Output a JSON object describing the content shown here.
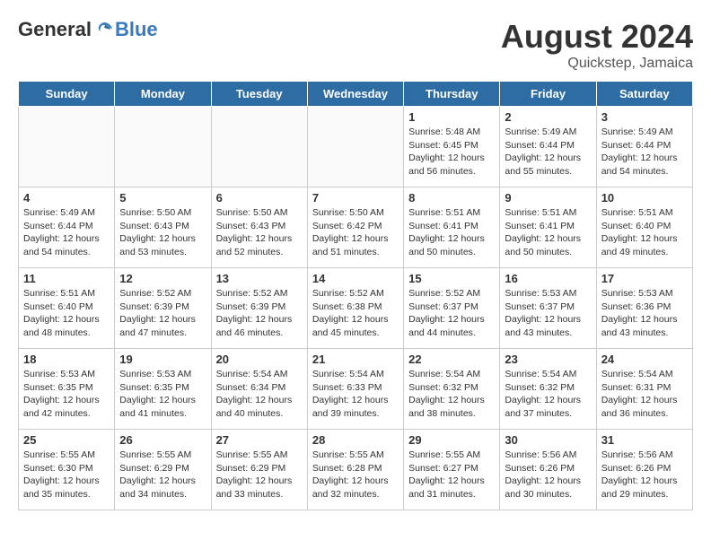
{
  "header": {
    "logo_general": "General",
    "logo_blue": "Blue",
    "month_year": "August 2024",
    "location": "Quickstep, Jamaica"
  },
  "days_of_week": [
    "Sunday",
    "Monday",
    "Tuesday",
    "Wednesday",
    "Thursday",
    "Friday",
    "Saturday"
  ],
  "weeks": [
    [
      {
        "day": "",
        "info": ""
      },
      {
        "day": "",
        "info": ""
      },
      {
        "day": "",
        "info": ""
      },
      {
        "day": "",
        "info": ""
      },
      {
        "day": "1",
        "info": "Sunrise: 5:48 AM\nSunset: 6:45 PM\nDaylight: 12 hours\nand 56 minutes."
      },
      {
        "day": "2",
        "info": "Sunrise: 5:49 AM\nSunset: 6:44 PM\nDaylight: 12 hours\nand 55 minutes."
      },
      {
        "day": "3",
        "info": "Sunrise: 5:49 AM\nSunset: 6:44 PM\nDaylight: 12 hours\nand 54 minutes."
      }
    ],
    [
      {
        "day": "4",
        "info": "Sunrise: 5:49 AM\nSunset: 6:44 PM\nDaylight: 12 hours\nand 54 minutes."
      },
      {
        "day": "5",
        "info": "Sunrise: 5:50 AM\nSunset: 6:43 PM\nDaylight: 12 hours\nand 53 minutes."
      },
      {
        "day": "6",
        "info": "Sunrise: 5:50 AM\nSunset: 6:43 PM\nDaylight: 12 hours\nand 52 minutes."
      },
      {
        "day": "7",
        "info": "Sunrise: 5:50 AM\nSunset: 6:42 PM\nDaylight: 12 hours\nand 51 minutes."
      },
      {
        "day": "8",
        "info": "Sunrise: 5:51 AM\nSunset: 6:41 PM\nDaylight: 12 hours\nand 50 minutes."
      },
      {
        "day": "9",
        "info": "Sunrise: 5:51 AM\nSunset: 6:41 PM\nDaylight: 12 hours\nand 50 minutes."
      },
      {
        "day": "10",
        "info": "Sunrise: 5:51 AM\nSunset: 6:40 PM\nDaylight: 12 hours\nand 49 minutes."
      }
    ],
    [
      {
        "day": "11",
        "info": "Sunrise: 5:51 AM\nSunset: 6:40 PM\nDaylight: 12 hours\nand 48 minutes."
      },
      {
        "day": "12",
        "info": "Sunrise: 5:52 AM\nSunset: 6:39 PM\nDaylight: 12 hours\nand 47 minutes."
      },
      {
        "day": "13",
        "info": "Sunrise: 5:52 AM\nSunset: 6:39 PM\nDaylight: 12 hours\nand 46 minutes."
      },
      {
        "day": "14",
        "info": "Sunrise: 5:52 AM\nSunset: 6:38 PM\nDaylight: 12 hours\nand 45 minutes."
      },
      {
        "day": "15",
        "info": "Sunrise: 5:52 AM\nSunset: 6:37 PM\nDaylight: 12 hours\nand 44 minutes."
      },
      {
        "day": "16",
        "info": "Sunrise: 5:53 AM\nSunset: 6:37 PM\nDaylight: 12 hours\nand 43 minutes."
      },
      {
        "day": "17",
        "info": "Sunrise: 5:53 AM\nSunset: 6:36 PM\nDaylight: 12 hours\nand 43 minutes."
      }
    ],
    [
      {
        "day": "18",
        "info": "Sunrise: 5:53 AM\nSunset: 6:35 PM\nDaylight: 12 hours\nand 42 minutes."
      },
      {
        "day": "19",
        "info": "Sunrise: 5:53 AM\nSunset: 6:35 PM\nDaylight: 12 hours\nand 41 minutes."
      },
      {
        "day": "20",
        "info": "Sunrise: 5:54 AM\nSunset: 6:34 PM\nDaylight: 12 hours\nand 40 minutes."
      },
      {
        "day": "21",
        "info": "Sunrise: 5:54 AM\nSunset: 6:33 PM\nDaylight: 12 hours\nand 39 minutes."
      },
      {
        "day": "22",
        "info": "Sunrise: 5:54 AM\nSunset: 6:32 PM\nDaylight: 12 hours\nand 38 minutes."
      },
      {
        "day": "23",
        "info": "Sunrise: 5:54 AM\nSunset: 6:32 PM\nDaylight: 12 hours\nand 37 minutes."
      },
      {
        "day": "24",
        "info": "Sunrise: 5:54 AM\nSunset: 6:31 PM\nDaylight: 12 hours\nand 36 minutes."
      }
    ],
    [
      {
        "day": "25",
        "info": "Sunrise: 5:55 AM\nSunset: 6:30 PM\nDaylight: 12 hours\nand 35 minutes."
      },
      {
        "day": "26",
        "info": "Sunrise: 5:55 AM\nSunset: 6:29 PM\nDaylight: 12 hours\nand 34 minutes."
      },
      {
        "day": "27",
        "info": "Sunrise: 5:55 AM\nSunset: 6:29 PM\nDaylight: 12 hours\nand 33 minutes."
      },
      {
        "day": "28",
        "info": "Sunrise: 5:55 AM\nSunset: 6:28 PM\nDaylight: 12 hours\nand 32 minutes."
      },
      {
        "day": "29",
        "info": "Sunrise: 5:55 AM\nSunset: 6:27 PM\nDaylight: 12 hours\nand 31 minutes."
      },
      {
        "day": "30",
        "info": "Sunrise: 5:56 AM\nSunset: 6:26 PM\nDaylight: 12 hours\nand 30 minutes."
      },
      {
        "day": "31",
        "info": "Sunrise: 5:56 AM\nSunset: 6:26 PM\nDaylight: 12 hours\nand 29 minutes."
      }
    ]
  ]
}
